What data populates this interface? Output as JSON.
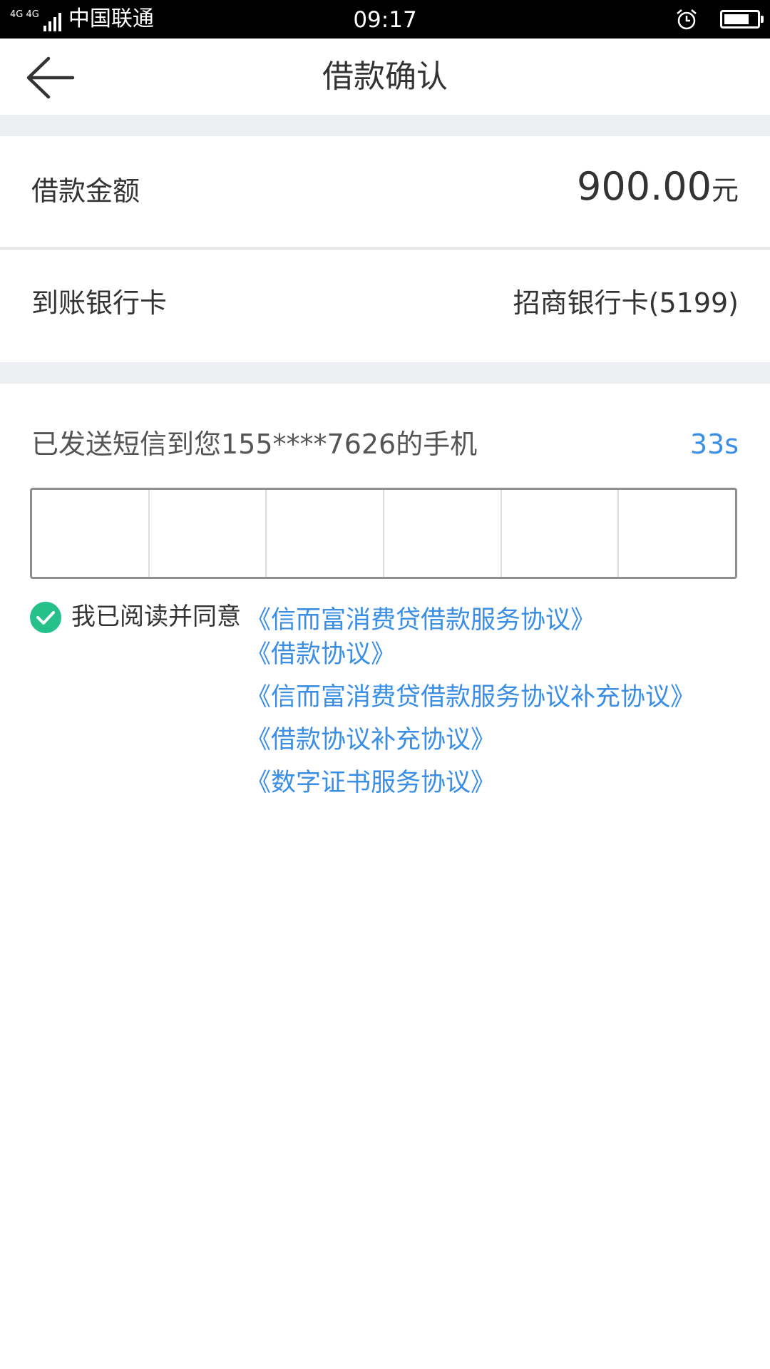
{
  "status_bar": {
    "network": "4G 4G",
    "carrier": "中国联通",
    "time": "09:17",
    "icons": [
      "signal-icon",
      "alarm-icon",
      "battery-icon"
    ]
  },
  "nav": {
    "title": "借款确认",
    "back_icon": "back-arrow-icon"
  },
  "loan": {
    "amount_label": "借款金额",
    "amount_value": "900.00",
    "amount_unit": "元",
    "card_label": "到账银行卡",
    "card_value": "招商银行卡(5199)"
  },
  "sms": {
    "message": "已发送短信到您155****7626的手机",
    "countdown": "33s",
    "code_length": 6
  },
  "agreement": {
    "checked": true,
    "prefix": "我已阅读并同意",
    "links": [
      "《信而富消费贷借款服务协议》",
      "《借款协议》",
      "《信而富消费贷借款服务协议补充协议》",
      "《借款协议补充协议》",
      "《数字证书服务协议》"
    ]
  },
  "colors": {
    "accent": "#3a8ee6",
    "check": "#26c08a",
    "separator": "#eeeff2"
  }
}
